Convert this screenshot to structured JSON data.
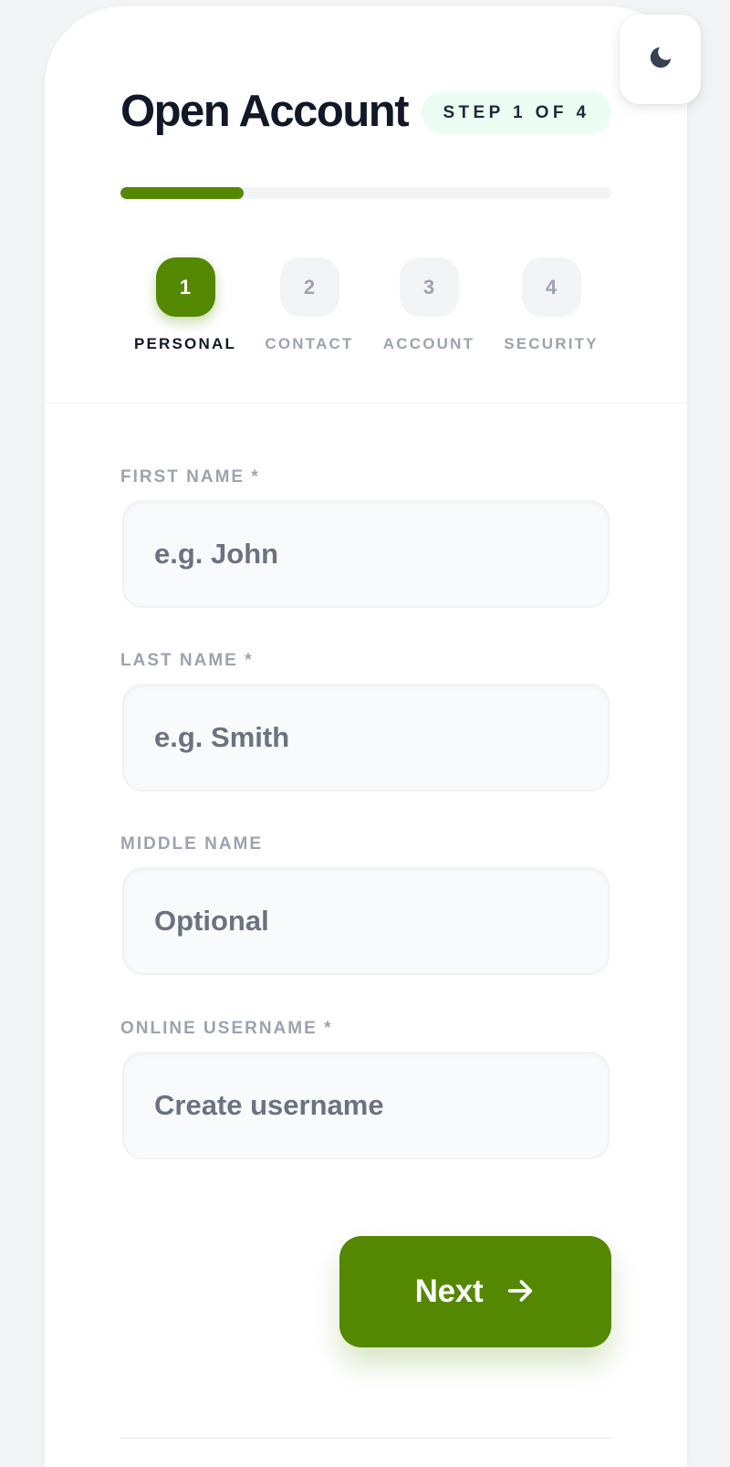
{
  "header": {
    "title": "Open Account",
    "step_badge": "STEP 1 OF 4",
    "progress": 0.25
  },
  "theme_toggle": {
    "icon": "moon-icon"
  },
  "steps": [
    {
      "number": "1",
      "label": "PERSONAL",
      "active": true
    },
    {
      "number": "2",
      "label": "CONTACT",
      "active": false
    },
    {
      "number": "3",
      "label": "ACCOUNT",
      "active": false
    },
    {
      "number": "4",
      "label": "SECURITY",
      "active": false
    }
  ],
  "form": {
    "first_name": {
      "label": "FIRST NAME *",
      "placeholder": "e.g. John",
      "value": ""
    },
    "last_name": {
      "label": "LAST NAME *",
      "placeholder": "e.g. Smith",
      "value": ""
    },
    "middle_name": {
      "label": "MIDDLE NAME",
      "placeholder": "Optional",
      "value": ""
    },
    "username": {
      "label": "ONLINE USERNAME *",
      "placeholder": "Create username",
      "value": ""
    }
  },
  "actions": {
    "next_label": "Next",
    "next_icon": "arrow-right-icon"
  },
  "colors": {
    "accent": "#538800",
    "badge_bg": "#ecfdf3",
    "text_dark": "#111827",
    "text_muted": "#9ca3af"
  }
}
